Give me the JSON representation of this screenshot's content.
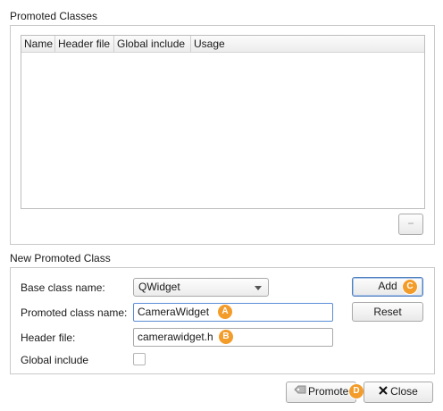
{
  "promoted_classes": {
    "title": "Promoted Classes",
    "columns": [
      "Name",
      "Header file",
      "Global include",
      "Usage"
    ],
    "remove_button_label": "−"
  },
  "new_promoted_class": {
    "title": "New Promoted Class",
    "base_class": {
      "label": "Base class name:",
      "value": "QWidget"
    },
    "promoted_name": {
      "label": "Promoted class name:",
      "value": "CameraWidget"
    },
    "header_file": {
      "label": "Header file:",
      "value": "camerawidget.h"
    },
    "global_include": {
      "label": "Global include",
      "checked": false
    },
    "add_label": "Add",
    "reset_label": "Reset"
  },
  "footer": {
    "promote_label": "Promote",
    "close_label": "Close"
  },
  "markers": {
    "a": "A",
    "b": "B",
    "c": "C",
    "d": "D"
  },
  "colors": {
    "marker": "#f39c2a",
    "focus": "#5b8dd6"
  }
}
